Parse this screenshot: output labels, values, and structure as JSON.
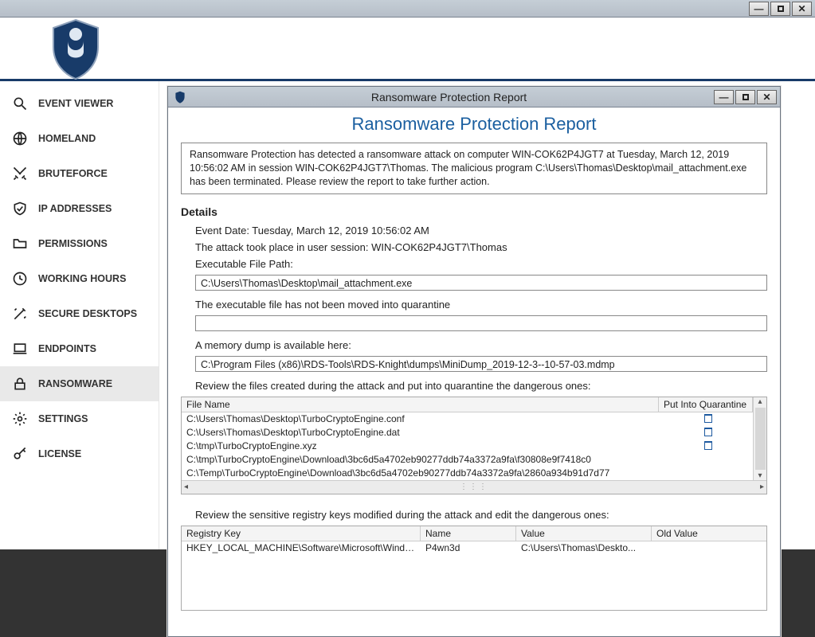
{
  "outerWindow": {
    "minimize": "—",
    "maximize": "",
    "close": "✕"
  },
  "sidebar": {
    "items": [
      {
        "label": "EVENT VIEWER",
        "icon": "search"
      },
      {
        "label": "HOMELAND",
        "icon": "globe"
      },
      {
        "label": "BRUTEFORCE",
        "icon": "swords"
      },
      {
        "label": "IP ADDRESSES",
        "icon": "shieldcheck"
      },
      {
        "label": "PERMISSIONS",
        "icon": "folder"
      },
      {
        "label": "WORKING HOURS",
        "icon": "clock"
      },
      {
        "label": "SECURE DESKTOPS",
        "icon": "wand"
      },
      {
        "label": "ENDPOINTS",
        "icon": "laptop"
      },
      {
        "label": "RANSOMWARE",
        "icon": "lock"
      },
      {
        "label": "SETTINGS",
        "icon": "gear"
      },
      {
        "label": "LICENSE",
        "icon": "key"
      }
    ],
    "activeIndex": 8
  },
  "report": {
    "windowTitle": "Ransomware Protection Report",
    "heading": "Ransomware Protection Report",
    "alert": "Ransomware Protection has detected a ransomware attack on computer WIN-COK62P4JGT7 at Tuesday, March 12, 2019 10:56:02 AM in session WIN-COK62P4JGT7\\Thomas. The malicious program C:\\Users\\Thomas\\Desktop\\mail_attachment.exe has been terminated. Please review the report to take further action.",
    "detailsLabel": "Details",
    "eventDateLine": "Event Date: Tuesday, March 12, 2019 10:56:02 AM",
    "sessionLine": "The attack took place in user session: WIN-COK62P4JGT7\\Thomas",
    "exePathLabel": "Executable File Path:",
    "exePath": "C:\\Users\\Thomas\\Desktop\\mail_attachment.exe",
    "quarantineNote": "The executable file has not been moved into quarantine",
    "quarantinePath": "",
    "dumpLabel": "A memory dump is available here:",
    "dumpPath": "C:\\Program Files (x86)\\RDS-Tools\\RDS-Knight\\dumps\\MiniDump_2019-12-3--10-57-03.mdmp",
    "filesLabel": "Review the files created during the attack and put into quarantine the dangerous ones:",
    "filesHeader": {
      "col1": "File Name",
      "col2": "Put Into Quarantine"
    },
    "files": [
      {
        "name": "C:\\Users\\Thomas\\Desktop\\TurboCryptoEngine.conf",
        "q": true
      },
      {
        "name": "C:\\Users\\Thomas\\Desktop\\TurboCryptoEngine.dat",
        "q": true
      },
      {
        "name": "C:\\tmp\\TurboCryptoEngine.xyz",
        "q": true
      },
      {
        "name": "C:\\tmp\\TurboCryptoEngine\\Download\\3bc6d5a4702eb90277ddb74a3372a9fa\\f30808e9f7418c0",
        "q": false
      },
      {
        "name": "C:\\Temp\\TurboCryptoEngine\\Download\\3bc6d5a4702eb90277ddb74a3372a9fa\\2860a934b91d7d77",
        "q": false
      }
    ],
    "regLabel": "Review the sensitive registry keys modified during the attack and edit the dangerous ones:",
    "regHeader": {
      "c1": "Registry Key",
      "c2": "Name",
      "c3": "Value",
      "c4": "Old Value"
    },
    "regRows": [
      {
        "c1": "HKEY_LOCAL_MACHINE\\Software\\Microsoft\\Windows\\...",
        "c2": "P4wn3d",
        "c3": "C:\\Users\\Thomas\\Deskto...",
        "c4": ""
      }
    ]
  }
}
